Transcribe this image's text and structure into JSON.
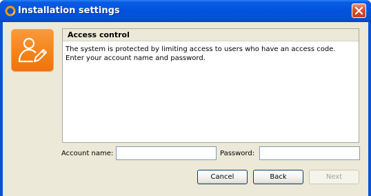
{
  "window": {
    "title": "Installation settings"
  },
  "icons": {
    "app": "app-ring-icon",
    "close": "close-x-icon",
    "user_edit": "user-edit-icon"
  },
  "colors": {
    "titlebar": "#0053de",
    "dialog_background": "#ece9d8",
    "accent_tile": "#f48419",
    "close_button": "#d9542f"
  },
  "panel": {
    "title": "Access control",
    "line1": "The system is protected by limiting access to users who have an access code.",
    "line2": "Enter your account name and password."
  },
  "form": {
    "account_label": "Account name:",
    "account_value": "",
    "password_label": "Password:",
    "password_value": ""
  },
  "buttons": {
    "cancel": "Cancel",
    "back": "Back",
    "next": "Next",
    "next_enabled": false
  }
}
